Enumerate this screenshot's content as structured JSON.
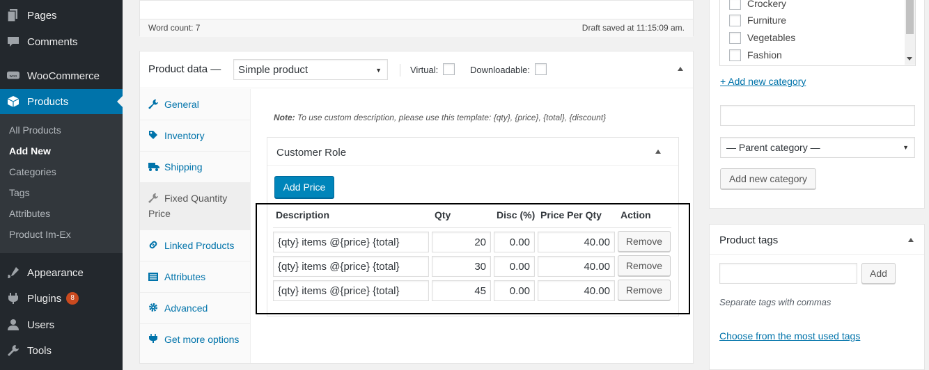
{
  "sidebar": {
    "items": [
      {
        "label": "Pages",
        "icon": "pages-icon"
      },
      {
        "label": "Comments",
        "icon": "comments-icon"
      },
      {
        "label": "WooCommerce",
        "icon": "woocommerce-icon"
      },
      {
        "label": "Products",
        "icon": "products-icon",
        "active": true
      },
      {
        "label": "Appearance",
        "icon": "appearance-icon"
      },
      {
        "label": "Plugins",
        "icon": "plugins-icon",
        "badge": "8"
      },
      {
        "label": "Users",
        "icon": "users-icon"
      },
      {
        "label": "Tools",
        "icon": "tools-icon"
      }
    ],
    "submenu": [
      {
        "label": "All Products"
      },
      {
        "label": "Add New",
        "current": true
      },
      {
        "label": "Categories"
      },
      {
        "label": "Tags"
      },
      {
        "label": "Attributes"
      },
      {
        "label": "Product Im-Ex"
      }
    ]
  },
  "editor": {
    "word_count": "Word count: 7",
    "draft_saved": "Draft saved at 11:15:09 am."
  },
  "product_data": {
    "title": "Product data —",
    "type_value": "Simple product",
    "virtual_label": "Virtual:",
    "downloadable_label": "Downloadable:",
    "tabs": [
      {
        "label": "General",
        "icon": "wrench-icon"
      },
      {
        "label": "Inventory",
        "icon": "tag-icon"
      },
      {
        "label": "Shipping",
        "icon": "truck-icon"
      },
      {
        "label": "Fixed Quantity",
        "label2": "Price",
        "icon": "wrench-icon",
        "active": true
      },
      {
        "label": "Linked Products",
        "icon": "link-icon"
      },
      {
        "label": "Attributes",
        "icon": "list-icon"
      },
      {
        "label": "Advanced",
        "icon": "gear-icon"
      },
      {
        "label": "Get more options",
        "icon": "plugin-icon"
      }
    ],
    "note_prefix": "Note:",
    "note_text": "To use custom description, please use this template: {qty}, {price}, {total}, {discount}",
    "role_title": "Customer Role",
    "add_price_label": "Add Price",
    "table": {
      "headers": [
        "Description",
        "Qty",
        "Disc (%)",
        "Price Per Qty",
        "Action"
      ],
      "rows": [
        {
          "description": "{qty} items @{price} {total}",
          "qty": "20",
          "disc": "0.00",
          "price": "40.00",
          "action": "Remove"
        },
        {
          "description": "{qty} items @{price} {total}",
          "qty": "30",
          "disc": "0.00",
          "price": "40.00",
          "action": "Remove"
        },
        {
          "description": "{qty} items @{price} {total}",
          "qty": "45",
          "disc": "0.00",
          "price": "40.00",
          "action": "Remove"
        }
      ]
    }
  },
  "categories": {
    "items": [
      "Crockery",
      "Furniture",
      "Vegetables",
      "Fashion"
    ],
    "add_new_link": "+ Add new category",
    "parent_select": "— Parent category —",
    "add_button": "Add new category"
  },
  "tags": {
    "title": "Product tags",
    "add_button": "Add",
    "hint": "Separate tags with commas",
    "choose_link": "Choose from the most used tags"
  },
  "colors": {
    "sidebar_bg": "#23282d",
    "active_blue": "#0073aa",
    "button_blue": "#0085ba",
    "badge": "#ca4a1f"
  }
}
